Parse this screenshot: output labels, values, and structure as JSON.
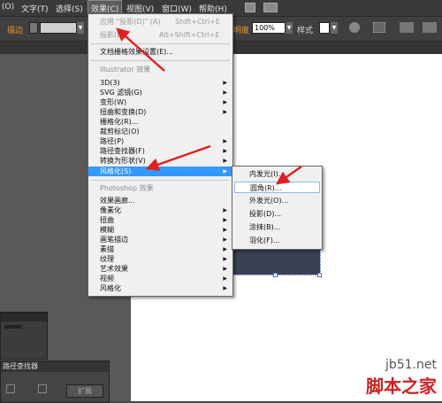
{
  "menubar": {
    "items": [
      "(O)",
      "文字(T)",
      "选择(S)",
      "效果(C)",
      "视图(V)",
      "窗口(W)",
      "帮助(H)"
    ]
  },
  "control_bar": {
    "stroke_label": "描边",
    "opacity_label": "明度",
    "opacity_value": "100%",
    "style_label": "样式"
  },
  "effect_menu": {
    "apply_label": "应用 \"投影(D)\" (A)",
    "apply_shortcut": "Shift+Ctrl+E",
    "shadow_label": "投影(D)...",
    "shadow_shortcut": "Alt+Shift+Ctrl+E",
    "raster_settings": "文档栅格效果设置(E)...",
    "illustrator_section": "Illustrator 效果",
    "illustrator_items": [
      "3D(3)",
      "SVG 滤镜(G)",
      "变形(W)",
      "扭曲和变换(D)",
      "栅格化(R)...",
      "裁剪标记(O)",
      "路径(P)",
      "路径查找器(F)",
      "转换为形状(V)",
      "风格化(S)"
    ],
    "photoshop_section": "Photoshop 效果",
    "photoshop_items": [
      "效果画廊...",
      "像素化",
      "扭曲",
      "模糊",
      "画笔描边",
      "素描",
      "纹理",
      "艺术效果",
      "视频",
      "风格化"
    ]
  },
  "stylize_submenu": {
    "items": [
      "内发光(I)...",
      "圆角(R)...",
      "外发光(O)...",
      "投影(D)...",
      "涂抹(B)...",
      "羽化(F)..."
    ]
  },
  "panels": {
    "pathfinder_title": "路径查找器",
    "expand_label": "扩展"
  },
  "watermark": {
    "url": "jb51.net",
    "name": "脚本之家"
  },
  "colors": {
    "highlight": "#3399ff",
    "arrow": "#e02020",
    "rectangle": "#3b4152"
  }
}
